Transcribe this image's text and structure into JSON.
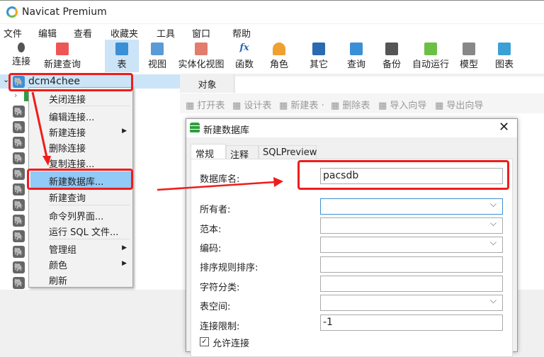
{
  "window": {
    "title": "Navicat Premium"
  },
  "menu": [
    "文件",
    "编辑",
    "查看",
    "收藏夹",
    "工具",
    "窗口",
    "帮助"
  ],
  "toolbar": [
    "连接",
    "新建查询",
    "表",
    "视图",
    "实体化视图",
    "函数",
    "角色",
    "其它",
    "查询",
    "备份",
    "自动运行",
    "模型",
    "图表"
  ],
  "tree": {
    "connection": "dcm4chee"
  },
  "context_menu": [
    "关闭连接",
    "编辑连接...",
    "新建连接",
    "删除连接",
    "复制连接...",
    "新建数据库...",
    "新建查询",
    "命令列界面...",
    "运行 SQL 文件...",
    "管理组",
    "颜色",
    "刷新"
  ],
  "objects": {
    "tab": "对象",
    "actions": [
      "打开表",
      "设计表",
      "新建表",
      "删除表",
      "导入向导",
      "导出向导"
    ]
  },
  "dialog": {
    "title": "新建数据库",
    "tabs": [
      "常规",
      "注释",
      "SQLPreview"
    ],
    "fields": [
      {
        "label": "数据库名:",
        "value": "pacsdb"
      },
      {
        "label": "所有者:",
        "value": ""
      },
      {
        "label": "范本:",
        "value": ""
      },
      {
        "label": "编码:",
        "value": ""
      },
      {
        "label": "排序规则排序:",
        "value": ""
      },
      {
        "label": "字符分类:",
        "value": ""
      },
      {
        "label": "表空间:",
        "value": ""
      },
      {
        "label": "连接限制:",
        "value": "-1"
      }
    ],
    "checkbox": "允许连接"
  },
  "colors": {
    "highlight": "#f01c1c",
    "selection": "#cce4f7",
    "menu_selected": "#91c9f7"
  }
}
